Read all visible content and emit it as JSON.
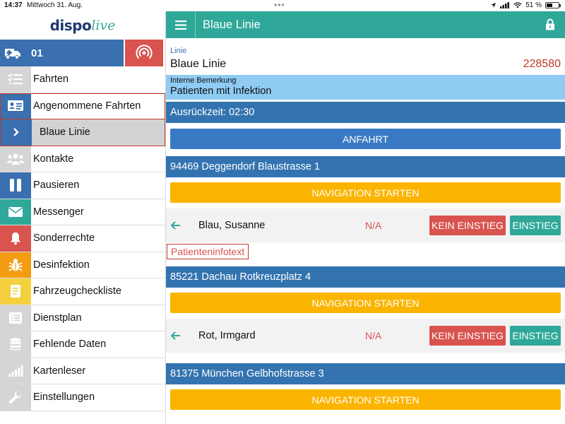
{
  "status": {
    "time": "14:37",
    "date": "Mittwoch 31. Aug.",
    "battery": "51 %",
    "battery_level": 0.51,
    "icons": [
      "location-arrow-icon",
      "signal-icon",
      "wifi-icon",
      "battery-icon"
    ]
  },
  "app": {
    "logo_part1": "dispo",
    "logo_part2": "live"
  },
  "vehicle": {
    "number": "01",
    "icon": "ambulance-icon",
    "radio_icon": "radio-signal-icon"
  },
  "menu": [
    {
      "label": "Fahrten",
      "icon": "checklist-icon"
    },
    {
      "label": "Angenommene Fahrten",
      "icon": "id-card-icon"
    },
    {
      "label": "Kontakte",
      "icon": "users-icon"
    },
    {
      "label": "Pausieren",
      "icon": "pause-icon"
    },
    {
      "label": "Messenger",
      "icon": "envelope-icon"
    },
    {
      "label": "Sonderrechte",
      "icon": "bell-icon"
    },
    {
      "label": "Desinfektion",
      "icon": "bug-icon"
    },
    {
      "label": "Fahrzeugcheckliste",
      "icon": "notepad-icon"
    },
    {
      "label": "Dienstplan",
      "icon": "list-icon"
    },
    {
      "label": "Fehlende Daten",
      "icon": "database-icon"
    },
    {
      "label": "Kartenleser",
      "icon": "signal-bars-icon"
    },
    {
      "label": "Einstellungen",
      "icon": "wrench-icon"
    }
  ],
  "submenu": {
    "label": "Blaue Linie",
    "icon": "chevron-right-icon"
  },
  "colors": {
    "teal": "#2fa89a",
    "blue": "#3374b0",
    "red": "#d9534f",
    "yellow": "#fbb400",
    "light_blue": "#8fcbf3"
  },
  "header": {
    "title": "Blaue Linie",
    "lock_icon": "lock-icon",
    "menu_icon": "hamburger-icon"
  },
  "detail": {
    "linie_label": "Linie",
    "linie_name": "Blaue Linie",
    "linie_number": "228580",
    "remark_label": "Interne Bemerkung",
    "remark_text": "Patienten mit Infektion",
    "departure": "Ausrückzeit: 02:30",
    "approach_button": "ANFAHRT"
  },
  "stops": [
    {
      "address": "94469 Deggendorf Blaustrasse 1",
      "nav_label": "NAVIGATION STARTEN",
      "passenger": "Blau, Susanne",
      "status": "N/A",
      "no_board_label": "KEIN EINSTIEG",
      "board_label": "EINSTIEG",
      "info_label": "Patienteninfotext"
    },
    {
      "address": "85221 Dachau Rotkreuzplatz 4",
      "nav_label": "NAVIGATION STARTEN",
      "passenger": "Rot, Irmgard",
      "status": "N/A",
      "no_board_label": "KEIN EINSTIEG",
      "board_label": "EINSTIEG"
    },
    {
      "address": "81375 München Gelbhofstrasse 3",
      "nav_label": "NAVIGATION STARTEN"
    }
  ]
}
